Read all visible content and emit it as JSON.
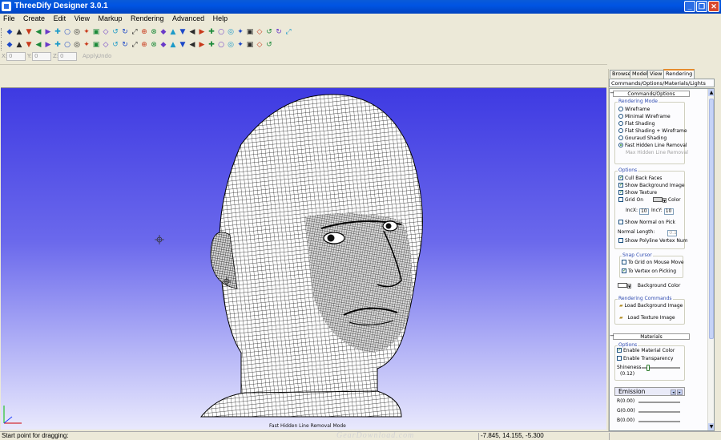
{
  "window": {
    "title": "ThreeDify Designer 3.0.1",
    "controls": {
      "minimize": "_",
      "maximize": "❐",
      "close": "✕"
    }
  },
  "menu": [
    "File",
    "Create",
    "Edit",
    "View",
    "Markup",
    "Rendering",
    "Advanced",
    "Help"
  ],
  "toolbar_row1": [
    "new",
    "open",
    "save",
    "save-all",
    "copy",
    "cut-x",
    "print",
    "preview",
    "copy-doc",
    "undo",
    "redo",
    "help-cursor",
    "tool-a",
    "tool-b",
    "tool-c",
    "tool-d",
    "tool-e",
    "tool-f",
    "tool-g",
    "tool-h",
    "tool-i",
    "tool-j",
    "tool-k",
    "tool-l",
    "tool-m",
    "tool-n",
    "tool-o",
    "tool-p",
    "tool-q",
    "tool-r"
  ],
  "toolbar_row2": [
    "select",
    "select-alt",
    "zoom-in",
    "zoom-out",
    "zoom-window",
    "zoom-extent",
    "pan-dot",
    "arrow-up",
    "arrow-down",
    "arrow-left",
    "arrow-right",
    "move-all",
    "move-x",
    "move-y",
    "move-z",
    "rotate-x",
    "rotate-y",
    "rotate-z",
    "view-a",
    "view-b",
    "view-c",
    "view-d",
    "view-e",
    "view-f",
    "view-g",
    "view-h",
    "view-i",
    "view-j"
  ],
  "coord_bar": {
    "x_label": "X:",
    "x_value": "0",
    "y_label": "Y:",
    "y_value": "0",
    "z_label": "Z:",
    "z_value": "0",
    "apply": "Apply",
    "undo": "Undo"
  },
  "viewport": {
    "caption": "Fast Hidden Line Removal Mode"
  },
  "panel": {
    "tabs": [
      "Browse",
      "Model",
      "View",
      "Rendering"
    ],
    "active_tab": "Rendering",
    "breadcrumb": "Commands/Options/Materials/Lights",
    "commands_header": "Commands/Options",
    "rendering_mode": {
      "title": "Rendering Mode",
      "options": [
        "Wireframe",
        "Minimal Wireframe",
        "Flat Shading",
        "Flat Shading + Wireframe",
        "Gouraud Shading",
        "Fast Hidden Line Removal",
        "Max Hidden Line Removal"
      ],
      "selected": "Fast Hidden Line Removal"
    },
    "options": {
      "title": "Options",
      "cull_back_faces": "Cull Back Faces",
      "show_background_image": "Show Background Image",
      "show_texture": "Show Texture",
      "grid_on": "Grid On",
      "color": "Color",
      "incx_label": "IncX:",
      "incx_value": "10",
      "incy_label": "IncY:",
      "incy_value": "10",
      "show_normal_on_pick": "Show Normal on Pick",
      "normal_length_label": "Normal Length:",
      "normal_length_value": "0.1",
      "show_polyline_vertex_num": "Show Polyline Vertex Num"
    },
    "snap_cursor": {
      "title": "Snap Cursor",
      "to_grid": "To Grid on Mouse Move",
      "to_vertex": "To Vertex on Picking"
    },
    "background_color": "Background Color",
    "rendering_commands": {
      "title": "Rendering Commands",
      "load_background": "Load Background Image",
      "load_texture": "Load Texture Image"
    },
    "materials_header": "Materials",
    "materials_options": {
      "title": "Options",
      "enable_material_color": "Enable Material Color",
      "enable_transparency": "Enable Transparency",
      "shininess_label": "Shineness",
      "shininess_value": "(0.12)",
      "shininess_level": 0.12
    },
    "emission": {
      "title": "Emission",
      "r": "R(0.00)",
      "g": "G(0.00)",
      "b": "B(0.00)"
    }
  },
  "status": {
    "text": "Start point for dragging:",
    "coords": "-7.845, 14.155, -5.300"
  },
  "watermark": "GearDownload.com",
  "colors": {
    "titlebar": "#0054e3",
    "viewport_top": "#3e3ae2",
    "viewport_bottom": "#e9e9fd",
    "accent_tab": "#e68b2c",
    "group_title": "#2f4bb0"
  }
}
